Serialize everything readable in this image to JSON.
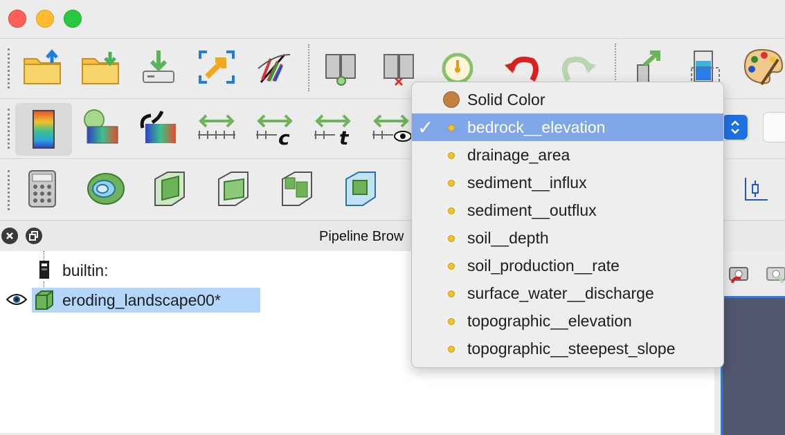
{
  "window": {
    "traffic_lights": {
      "close": "close",
      "minimize": "minimize",
      "zoom": "zoom"
    }
  },
  "toolbar_1": {
    "icons": [
      "open-folder-icon",
      "load-state-icon",
      "save-data-icon",
      "reset-camera-icon",
      "scientific-icon",
      "connect-server-icon",
      "disconnect-server-icon",
      "timer-icon",
      "undo-icon",
      "redo-icon",
      "rescale-icon",
      "edit-colormap-icon",
      "palette-icon"
    ]
  },
  "toolbar_2": {
    "icons": [
      "color-legend-icon",
      "edit-color-map-icon",
      "link-color-map-icon",
      "rescale-range-icon",
      "rescale-custom-icon",
      "rescale-temporal-icon",
      "rescale-visible-icon"
    ]
  },
  "toolbar_3": {
    "icons": [
      "calculator-icon",
      "contour-icon",
      "clip-icon",
      "slice-icon",
      "threshold-icon",
      "extract-subset-icon",
      "plot-over-line-icon"
    ]
  },
  "pipeline": {
    "title": "Pipeline Brow",
    "items": [
      {
        "label": "builtin:",
        "selected": false
      },
      {
        "label": "eroding_landscape00*",
        "selected": true
      }
    ]
  },
  "color_dropdown": {
    "selected": "bedrock__elevation",
    "options": [
      {
        "label": "Solid Color",
        "type": "solid"
      },
      {
        "label": "bedrock__elevation",
        "type": "point"
      },
      {
        "label": "drainage_area",
        "type": "point"
      },
      {
        "label": "sediment__influx",
        "type": "point"
      },
      {
        "label": "sediment__outflux",
        "type": "point"
      },
      {
        "label": "soil__depth",
        "type": "point"
      },
      {
        "label": "soil_production__rate",
        "type": "point"
      },
      {
        "label": "surface_water__discharge",
        "type": "point"
      },
      {
        "label": "topographic__elevation",
        "type": "point"
      },
      {
        "label": "topographic__steepest_slope",
        "type": "point"
      }
    ],
    "check_mark": "✓"
  },
  "colors": {
    "selection_highlight": "#7fa7e8",
    "pipeline_selection": "#b4d6fb",
    "solid_color_swatch": "#c4803f",
    "point_dot": "#f2c12e",
    "accent_blue": "#1f6fe5"
  }
}
